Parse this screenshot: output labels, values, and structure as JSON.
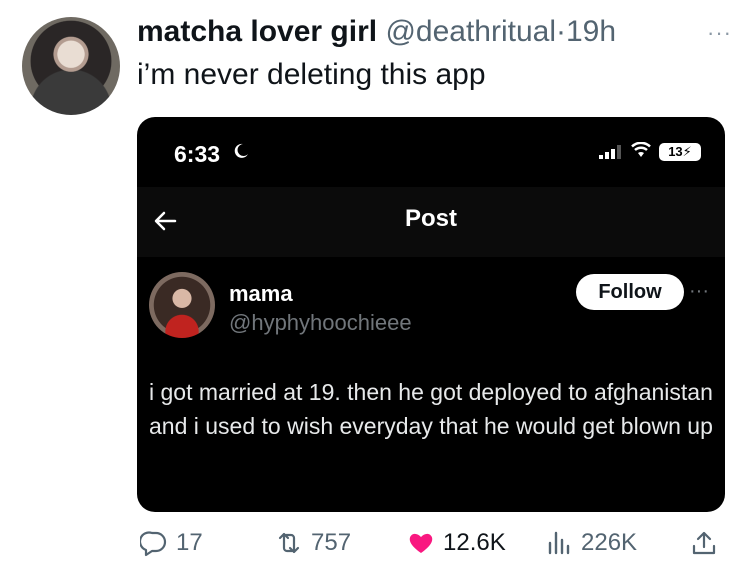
{
  "tweet": {
    "display_name": "matcha lover girl",
    "handle": "@deathritual",
    "separator": "·",
    "time": "19h",
    "text": "i’m never deleting this app",
    "more": "···"
  },
  "phone": {
    "status_time": "6:33",
    "battery": "13",
    "title": "Post",
    "post": {
      "name": "mama",
      "handle": "@hyphyhoochieee",
      "follow_label": "Follow",
      "more": "···",
      "text": "i got married at 19. then he got deployed to afghanistan and i used to wish everyday that he would get blown up"
    }
  },
  "actions": {
    "replies": "17",
    "reposts": "757",
    "likes": "12.6K",
    "views": "226K"
  },
  "colors": {
    "like": "#f91880",
    "muted": "#536471"
  }
}
